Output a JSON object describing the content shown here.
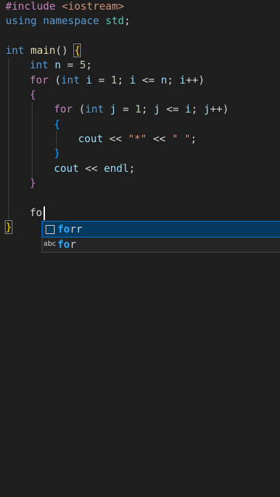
{
  "editor": {
    "lines": {
      "l1": {
        "directive": "#include",
        "space": " ",
        "header": "<iostream>"
      },
      "l2": {
        "kw1": "using",
        "kw2": "namespace",
        "ns": "std",
        "semi": ";"
      },
      "l4": {
        "type": "int",
        "func": "main",
        "parens": "()",
        "brace": "{"
      },
      "l5": {
        "type": "int",
        "var": "n",
        "eq": " = ",
        "num": "5",
        "semi": ";"
      },
      "l6": {
        "kw": "for",
        "open": " (",
        "type": "int",
        "var1": "i",
        "eq": " = ",
        "num": "1",
        "rest1": "; ",
        "var2": "i",
        "le": " <= ",
        "var3": "n",
        "sep": "; ",
        "var4": "i",
        "inc": "++",
        "close": ")"
      },
      "l7": {
        "brace": "{"
      },
      "l8": {
        "kw": "for",
        "open": " (",
        "type": "int",
        "var1": "j",
        "eq": " = ",
        "num": "1",
        "rest1": "; ",
        "var2": "j",
        "le": " <= ",
        "var3": "i",
        "sep": "; ",
        "var4": "j",
        "inc": "++",
        "close": ")"
      },
      "l9": {
        "brace": "{"
      },
      "l10": {
        "var": "cout",
        "op1": " << ",
        "str1": "\"*\"",
        "op2": " << ",
        "str2": "\" \"",
        "semi": ";"
      },
      "l11": {
        "brace": "}"
      },
      "l12": {
        "var1": "cout",
        "op": " << ",
        "var2": "endl",
        "semi": ";"
      },
      "l13": {
        "brace": "}"
      },
      "l15": {
        "typed": "fo"
      },
      "l16": {
        "brace": "}"
      }
    }
  },
  "suggestions": [
    {
      "icon": "snippet-icon",
      "match": "fo",
      "rest": "rr",
      "selected": true
    },
    {
      "icon": "abc",
      "match": "fo",
      "rest": "r",
      "selected": false
    }
  ]
}
